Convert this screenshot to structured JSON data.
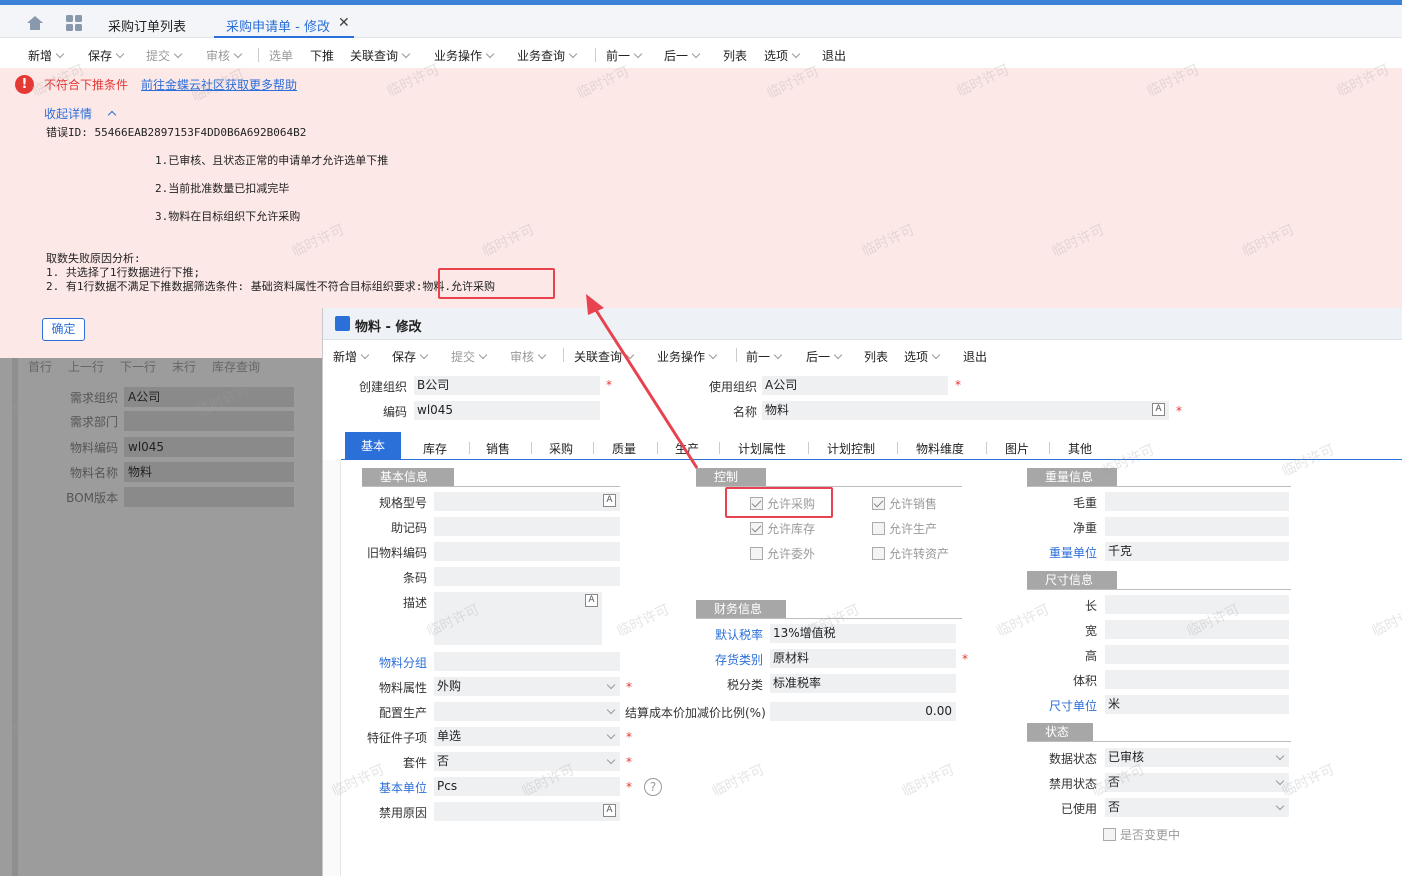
{
  "tabs": {
    "tab1": "采购订单列表",
    "tab2": "采购申请单 - 修改"
  },
  "toolbar": {
    "new": "新增",
    "save": "保存",
    "submit": "提交",
    "audit": "审核",
    "select": "选单",
    "push": "下推",
    "related": "关联查询",
    "bizop": "业务操作",
    "bizquery": "业务查询",
    "prev": "前一",
    "next": "后一",
    "list": "列表",
    "options": "选项",
    "exit": "退出"
  },
  "error": {
    "title": "不符合下推条件",
    "help_link": "前往金蝶云社区获取更多帮助",
    "collapse": "收起详情",
    "error_id": "错误ID: 55466EAB2897153F4DD0B6A692B064B2",
    "rule1": "1.已审核、且状态正常的申请单才允许选单下推",
    "rule2": "2.当前批准数量已扣减完毕",
    "rule3": "3.物料在目标组织下允许采购",
    "analysis": "取数失败原因分析:",
    "line1": "1. 共选择了1行数据进行下推;",
    "line2": "2. 有1行数据不满足下推数据筛选条件: 基础资料属性不符合目标组织要求:物料.允许采购",
    "confirm": "确定"
  },
  "bg": {
    "toolbar": [
      "首行",
      "上一行",
      "下一行",
      "末行",
      "库存查询"
    ],
    "labels": [
      "需求组织",
      "需求部门",
      "物料编码",
      "物料名称",
      "BOM版本"
    ],
    "values": [
      "A公司",
      "",
      "wl045",
      "物料",
      ""
    ]
  },
  "modal": {
    "title": "物料 - 修改",
    "toolbar": {
      "new": "新增",
      "save": "保存",
      "submit": "提交",
      "audit": "审核",
      "related": "关联查询",
      "bizop": "业务操作",
      "prev": "前一",
      "next": "后一",
      "list": "列表",
      "options": "选项",
      "exit": "退出"
    },
    "header": {
      "create_org_label": "创建组织",
      "create_org": "B公司",
      "use_org_label": "使用组织",
      "use_org": "A公司",
      "code_label": "编码",
      "code": "wl045",
      "name_label": "名称",
      "name": "物料"
    },
    "tabs": [
      "基本",
      "库存",
      "销售",
      "采购",
      "质量",
      "生产",
      "计划属性",
      "计划控制",
      "物料维度",
      "图片",
      "其他"
    ],
    "basic": {
      "group": "基本信息",
      "spec": "规格型号",
      "mnemonic": "助记码",
      "old_code": "旧物料编码",
      "barcode": "条码",
      "desc": "描述",
      "category": "物料分组",
      "attr_label": "物料属性",
      "attr": "外购",
      "config_label": "配置生产",
      "feature_label": "特征件子项",
      "feature": "单选",
      "kit_label": "套件",
      "kit": "否",
      "unit_label": "基本单位",
      "unit": "Pcs",
      "disable_reason": "禁用原因"
    },
    "control": {
      "group": "控制",
      "allow_purchase": "允许采购",
      "allow_sale": "允许销售",
      "allow_stock": "允许库存",
      "allow_produce": "允许生产",
      "allow_outsource": "允许委外",
      "allow_asset": "允许转资产"
    },
    "finance": {
      "group": "财务信息",
      "tax_label": "默认税率",
      "tax": "13%增值税",
      "stock_type_label": "存货类别",
      "stock_type": "原材料",
      "tax_class_label": "税分类",
      "tax_class": "标准税率",
      "cost_ratio_label": "结算成本价加减价比例(%)",
      "cost_ratio": "0.00"
    },
    "weight": {
      "group": "重量信息",
      "gross": "毛重",
      "net": "净重",
      "unit_label": "重量单位",
      "unit": "千克"
    },
    "size": {
      "group": "尺寸信息",
      "length": "长",
      "width": "宽",
      "height": "高",
      "volume": "体积",
      "unit_label": "尺寸单位",
      "unit": "米"
    },
    "status": {
      "group": "状态",
      "data_label": "数据状态",
      "data": "已审核",
      "forbid_label": "禁用状态",
      "forbid": "否",
      "used_label": "已使用",
      "used": "否",
      "changing": "是否变更中"
    }
  },
  "watermark": "临时许可",
  "colors": {
    "accent": "#2b6fd8",
    "error": "#e53935",
    "highlight": "#e8424f"
  }
}
